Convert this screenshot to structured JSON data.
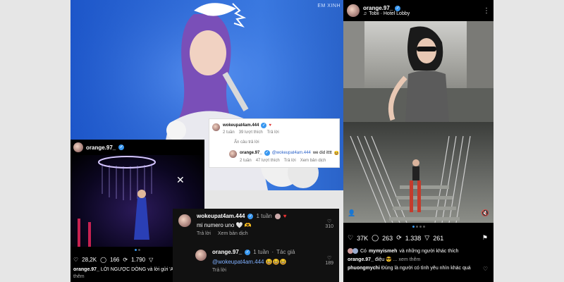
{
  "watermark": "EM XINH",
  "hero_comment": {
    "top": {
      "user": "wokeupat4am.444",
      "meta_time": "2 tuần",
      "meta_likes": "39 lượt thích",
      "meta_reply": "Trả lời"
    },
    "hide_replies": "Ẩn câu trả lời",
    "reply": {
      "user": "orange.97_",
      "mention": "@wokeupat4am.444",
      "text": "we did itttt",
      "meta_time": "2 tuần",
      "meta_likes": "47 lượt thích",
      "meta_reply": "Trả lời",
      "meta_translate": "Xem bản dịch"
    }
  },
  "left_post": {
    "username": "orange.97_",
    "likes": "28,2K",
    "comments": "166",
    "reposts": "1.790",
    "caption_user": "orange.97_",
    "caption_text": "LỜI NGƯỢC DÒNG và lời gửi 'Ac",
    "more": "thêm"
  },
  "dark_comment": {
    "top": {
      "user": "wokeupat4am.444",
      "time": "1 tuần",
      "text": "mi numero uno",
      "reply": "Trả lời",
      "translate": "Xem bản dịch",
      "likes": "310"
    },
    "reply": {
      "user": "orange.97_",
      "time": "1 tuần",
      "author": "Tác giả",
      "mention": "@wokeupat4am.444",
      "reply": "Trả lời",
      "likes": "189"
    }
  },
  "right_post": {
    "username": "orange.97_",
    "music": "Tobii · Hotel Lobby",
    "likes": "37K",
    "comments": "263",
    "reposts": "1.338",
    "shares": "261",
    "liked_by_prefix": "Có",
    "liked_by_user": "mymyismeh",
    "liked_by_suffix": "và những người khác thích",
    "caption_user": "orange.97_",
    "caption_text": "điệu",
    "caption_more": "... xem thêm",
    "comment_user": "phuongmychi",
    "comment_text": "Đúng là người có tình yêu nhìn khác quá"
  }
}
